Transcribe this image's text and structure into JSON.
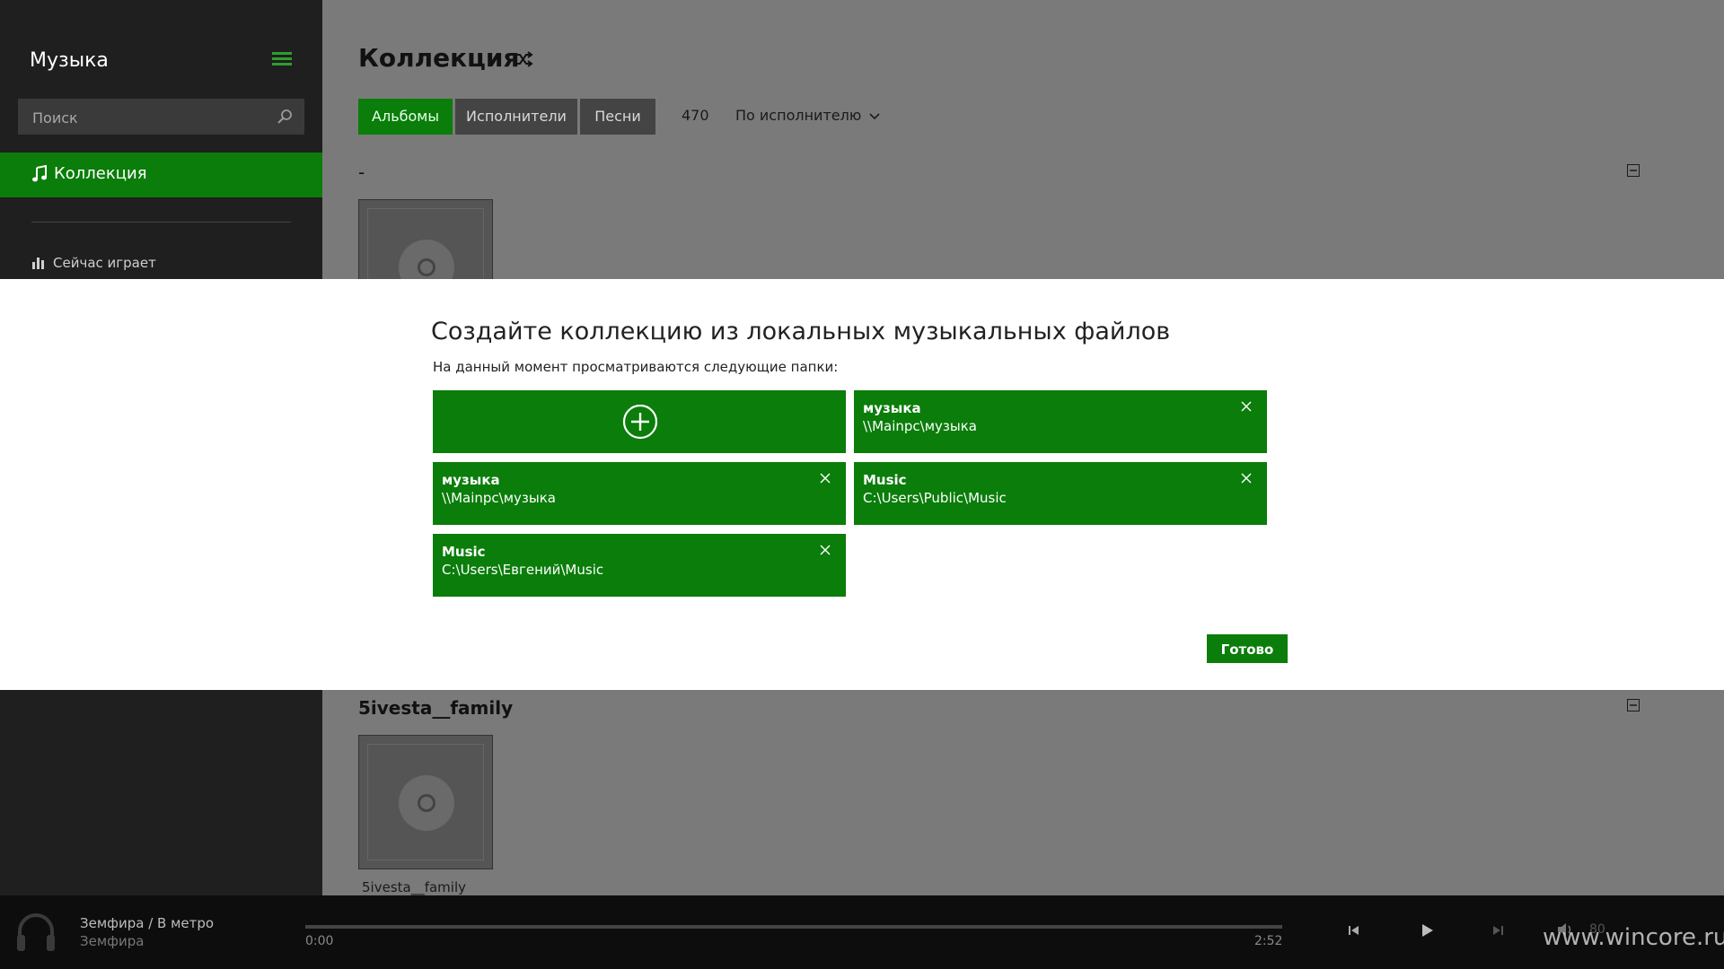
{
  "sidebar": {
    "app_title": "Музыка",
    "search_placeholder": "Поиск",
    "nav_collection": "Коллекция",
    "nav_now_playing": "Сейчас играет"
  },
  "main": {
    "page_title": "Коллекция",
    "tabs": [
      {
        "label": "Альбомы",
        "active": true
      },
      {
        "label": "Исполнители",
        "active": false
      },
      {
        "label": "Песни",
        "active": false
      }
    ],
    "item_count": "470",
    "sort_label": "По исполнителю",
    "groups": [
      {
        "header": "-"
      },
      {
        "header": "5ivesta__family",
        "album_title": "5ivesta__family"
      }
    ]
  },
  "dialog": {
    "title": "Создайте коллекцию из локальных музыкальных файлов",
    "subtitle": "На данный момент просматриваются следующие папки:",
    "folders": [
      {
        "name": "музыка",
        "path": "\\\\Mainpc\\музыка"
      },
      {
        "name": "музыка",
        "path": "\\\\Mainpc\\музыка"
      },
      {
        "name": "Music",
        "path": "C:\\Users\\Public\\Music"
      },
      {
        "name": "Music",
        "path": "C:\\Users\\Евгений\\Music"
      }
    ],
    "done_label": "Готово"
  },
  "player": {
    "track_title": "Земфира / В метро",
    "track_artist": "Земфира",
    "time_current": "0:00",
    "time_total": "2:52",
    "volume": "80",
    "progress": 0
  },
  "watermark": "www.wincore.ru",
  "colors": {
    "accent": "#0a7d0a",
    "sidebar_bg": "#1f1f1f",
    "main_bg": "#7a7a7a",
    "player_bg": "#0d0d0d"
  }
}
